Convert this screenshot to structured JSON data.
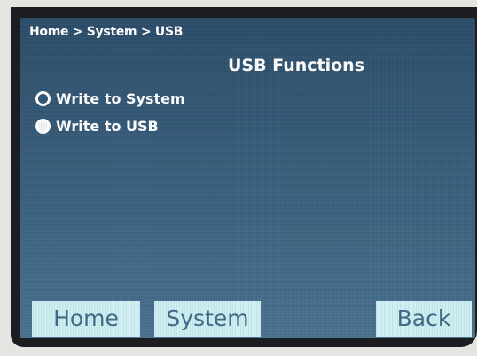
{
  "header": {
    "breadcrumb": "Home > System > USB",
    "title": "USB Functions"
  },
  "options": [
    {
      "label": "Write to System",
      "selected": false
    },
    {
      "label": "Write to USB",
      "selected": true
    }
  ],
  "footer": {
    "home_label": "Home",
    "system_label": "System",
    "back_label": "Back"
  },
  "colors": {
    "screen_background": "#355a77",
    "button_background": "#cdeef2",
    "button_text": "#3e6c86",
    "text": "#ffffff"
  }
}
